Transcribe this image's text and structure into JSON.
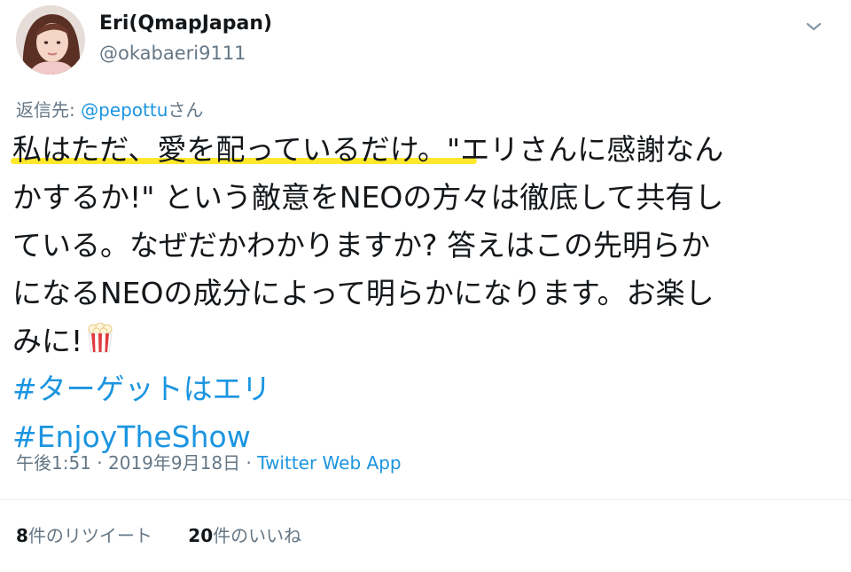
{
  "user": {
    "display_name": "Eri(QmapJapan)",
    "handle": "@okabaeri9111"
  },
  "reply": {
    "prefix": "返信先:",
    "mention": "@pepottu",
    "suffix": "さん"
  },
  "tweet": {
    "lines": [
      "私はただ、愛を配っているだけ。\"エリさんに感謝なん",
      "かするか!\" という敵意をNEOの方々は徹底して共有し",
      "ている。なぜだかわかりますか? 答えはこの先明らか",
      "になるNEOの成分によって明らかになります。お楽し",
      "みに!"
    ],
    "emoji": "popcorn-icon",
    "hashtags": [
      "#ターゲットはエリ",
      "#EnjoyTheShow"
    ]
  },
  "meta": {
    "time": "午後1:51",
    "separator1": "·",
    "date": "2019年9月18日",
    "separator2": "·",
    "source": "Twitter Web App"
  },
  "stats": {
    "retweets_count": "8",
    "retweets_label": "件のリツイート",
    "likes_count": "20",
    "likes_label": "件のいいね"
  },
  "colors": {
    "link": "#1b95e0",
    "secondary_text": "#657786",
    "highlight": "#ffe82b"
  }
}
